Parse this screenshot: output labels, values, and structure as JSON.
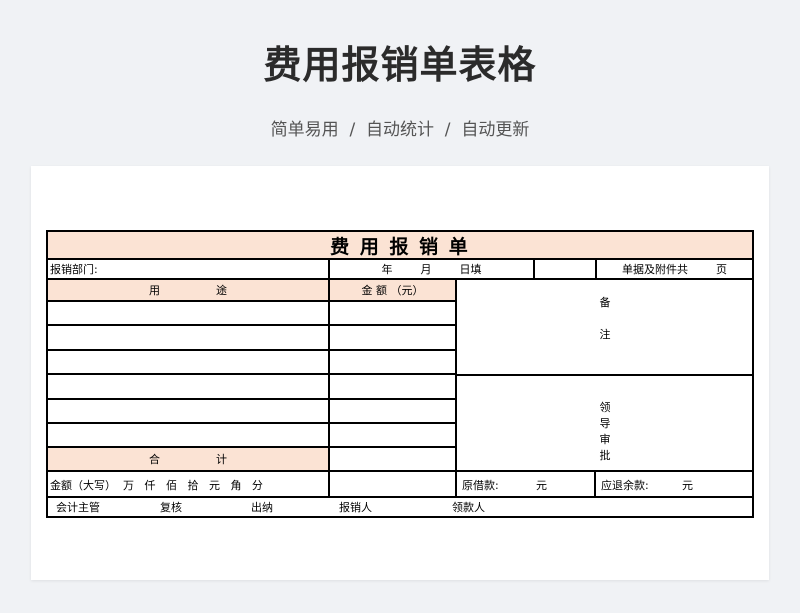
{
  "header": {
    "title": "费用报销单表格",
    "subtitle": "简单易用  /  自动统计  /  自动更新"
  },
  "form": {
    "title": "费 用 报 销 单",
    "department_label": "报销部门:",
    "date_label": "年        月        日填",
    "attachments_label": "单据及附件共        页",
    "col_purpose": "用                途",
    "col_amount": "金 额 （元）",
    "remarks_chars": [
      "备",
      "注"
    ],
    "approval_chars": [
      "领",
      "导",
      "审",
      "批"
    ],
    "total_label": "合                计",
    "amount_words_label": "金额（大写）  万   仟   佰   拾   元   角   分",
    "borrowed_label": "原借款:",
    "borrowed_unit": "元",
    "refund_label": "应退余款:",
    "refund_unit": "元",
    "footer": {
      "accountant": "会计主管",
      "reviewer": "复核",
      "cashier": "出纳",
      "claimant": "报销人",
      "recipient": "领款人"
    }
  },
  "colors": {
    "header_fill": "#fbe3d4",
    "background": "#f0f2f5"
  }
}
